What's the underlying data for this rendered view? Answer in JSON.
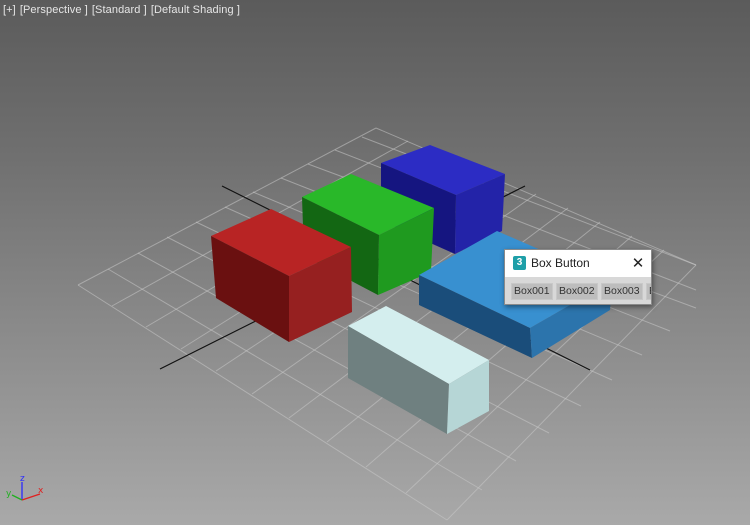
{
  "viewport": {
    "labels": [
      "[+]",
      "[Perspective ]",
      "[Standard ]",
      "[Default Shading ]"
    ]
  },
  "scene": {
    "objects": [
      {
        "name": "red-box",
        "color": "#b02020"
      },
      {
        "name": "green-box",
        "color": "#22a822"
      },
      {
        "name": "blue-box",
        "color": "#2424b0"
      },
      {
        "name": "light-blue-box",
        "color": "#2f7dbd"
      },
      {
        "name": "white-box",
        "color": "#c4e2e2"
      }
    ]
  },
  "axis_gizmo": {
    "x_label": "x",
    "y_label": "y",
    "z_label": "z"
  },
  "dialog": {
    "title": "Box Button",
    "app_icon_glyph": "3",
    "close_glyph": "✕",
    "buttons": [
      "Box001",
      "Box002",
      "Box003",
      "B"
    ]
  }
}
